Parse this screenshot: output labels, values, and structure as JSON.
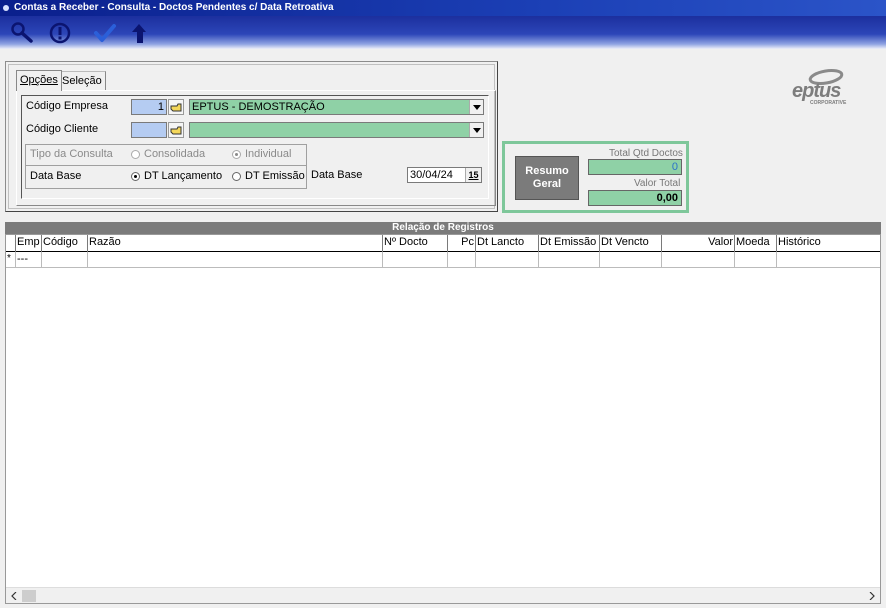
{
  "window": {
    "title": "Contas a Receber - Consulta - Doctos Pendentes c/ Data Retroativa"
  },
  "toolbar": {
    "buttons": [
      {
        "name": "search",
        "icon": "search-icon"
      },
      {
        "name": "alert",
        "icon": "exclamation-circle-icon"
      },
      {
        "name": "confirm",
        "icon": "checkmark-icon"
      },
      {
        "name": "back",
        "icon": "return-arrow-icon"
      }
    ]
  },
  "tabs": [
    {
      "label": "Opções",
      "active": true
    },
    {
      "label": "Seleção",
      "active": false
    }
  ],
  "form": {
    "empresa_label": "Código Empresa",
    "empresa_code": "1",
    "empresa_name": "EPTUS - DEMOSTRAÇÃO",
    "cliente_label": "Código Cliente",
    "cliente_code": "",
    "cliente_name": "",
    "tipo_consulta_label": "Tipo da Consulta",
    "tipo_consulta_options": [
      "Consolidada",
      "Individual"
    ],
    "tipo_consulta_selected": "Individual",
    "data_base_label": "Data Base",
    "data_base_options": [
      "DT Lançamento",
      "DT Emissão"
    ],
    "data_base_selected": "DT Lançamento",
    "data_base_value_label": "Data Base",
    "data_base_value": "30/04/24",
    "calendar_btn": "15"
  },
  "logo": {
    "text": "eptus",
    "subtext": "CORPORATIVE"
  },
  "resumo": {
    "button_label": "Resumo Geral",
    "total_qtd_label": "Total Qtd Doctos",
    "total_qtd_value": "0",
    "valor_total_label": "Valor Total",
    "valor_total_value": "0,00"
  },
  "grid": {
    "title": "Relação de Registros",
    "columns": [
      "Emp",
      "Código",
      "Razão",
      "Nº Docto",
      "Pc",
      "Dt Lancto",
      "Dt Emissão",
      "Dt Vencto",
      "Valor",
      "Moeda",
      "Histórico"
    ],
    "rows": [
      {
        "marker": "*",
        "emp": "---"
      }
    ]
  },
  "colors": {
    "title_bar": "#0a1f8c",
    "field_blue": "#b5ccf2",
    "field_green": "#8fd1a6",
    "grid_header": "#7b7b7b"
  }
}
